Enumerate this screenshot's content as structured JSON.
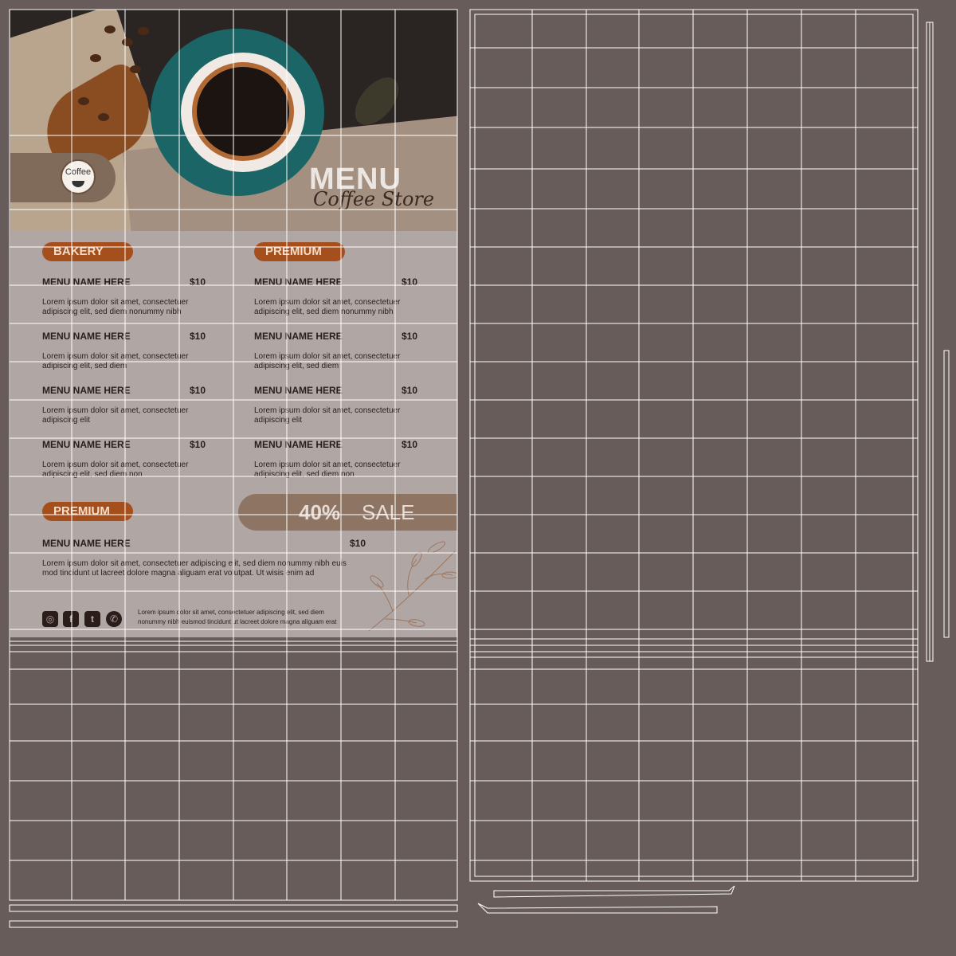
{
  "menu": {
    "badge_text": "Coffee",
    "title": "MENU",
    "subtitle": "Coffee Store",
    "bakery": {
      "label": "BAKERY",
      "items": [
        {
          "name": "MENU NAME HERE",
          "price": "$10",
          "desc1": "Lorem ipsum dolor sit amet, consectetuer",
          "desc2": "adipiscing elit, sed diem nonummy nibh"
        },
        {
          "name": "MENU NAME HERE",
          "price": "$10",
          "desc1": "Lorem ipsum dolor sit amet, consectetuer",
          "desc2": "adipiscing elit, sed diem"
        },
        {
          "name": "MENU NAME HERE",
          "price": "$10",
          "desc1": "Lorem ipsum dolor sit amet, consectetuer",
          "desc2": "adipiscing elit"
        },
        {
          "name": "MENU NAME HERE",
          "price": "$10",
          "desc1": "Lorem ipsum dolor sit amet, consectetuer",
          "desc2": "adipiscing elit, sed diem non"
        }
      ]
    },
    "premium_right": {
      "label": "PREMIUM",
      "items": [
        {
          "name": "MENU NAME HERE",
          "price": "$10",
          "desc1": "Lorem ipsum dolor sit amet, consectetuer",
          "desc2": "adipiscing elit, sed diem nonummy nibh"
        },
        {
          "name": "MENU NAME HERE",
          "price": "$10",
          "desc1": "Lorem ipsum dolor sit amet, consectetuer",
          "desc2": "adipiscing elit, sed diem"
        },
        {
          "name": "MENU NAME HERE",
          "price": "$10",
          "desc1": "Lorem ipsum dolor sit amet, consectetuer",
          "desc2": "adipiscing elit"
        },
        {
          "name": "MENU NAME HERE",
          "price": "$10",
          "desc1": "Lorem ipsum dolor sit amet, consectetuer",
          "desc2": "adipiscing elit, sed diem non"
        }
      ]
    },
    "premium_bottom": {
      "label": "PREMIUM",
      "name": "MENU NAME HERE",
      "price": "$10",
      "desc1": "Lorem ipsum dolor sit amet, consectetuer adipiscing elit, sed diem nonummy nibh euis",
      "desc2": "mod tincidunt ut lacreet dolore magna aliguam erat volutpat. Ut wisis enim ad"
    },
    "sale": {
      "percent": "40%",
      "word": "SALE"
    },
    "footer": {
      "line1": "Lorem ipsum dolor sit amet, consectetuer adipiscing elit, sed diem",
      "line2": "nonummy nibh euismod tincidunt ut lacreet dolore magna aliguam erat"
    },
    "socials": [
      "instagram-icon",
      "facebook-icon",
      "twitter-icon",
      "whatsapp-icon"
    ]
  },
  "colors": {
    "background": "#685c5b",
    "panel": "#b0a7a4",
    "accent": "#a54f1c",
    "sale_band": "#8d7463",
    "wire": "#ffffff"
  }
}
